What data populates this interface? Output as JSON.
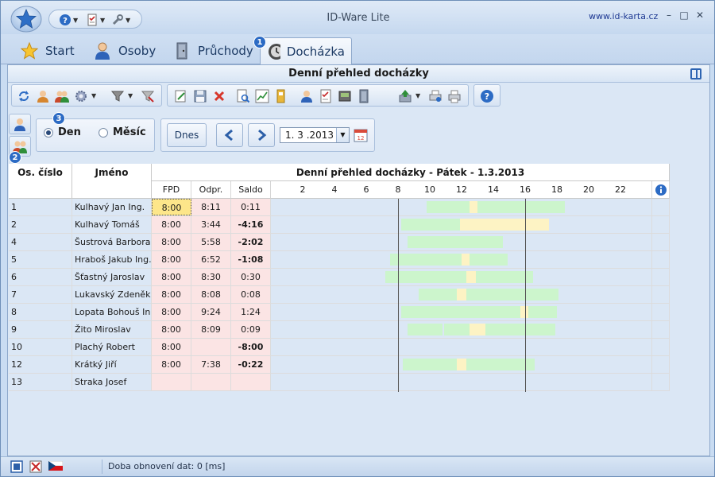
{
  "window": {
    "title": "ID-Ware Lite",
    "site_link": "www.id-karta.cz",
    "controls": [
      "minimize",
      "maximize",
      "close"
    ]
  },
  "tabs": [
    {
      "label": "Start",
      "icon": "star-icon",
      "active": false
    },
    {
      "label": "Osoby",
      "icon": "person-icon",
      "active": false
    },
    {
      "label": "Průchody",
      "icon": "door-icon",
      "active": false
    },
    {
      "label": "Docházka",
      "icon": "clock-icon",
      "active": true
    }
  ],
  "badges": {
    "tab": "1",
    "vtab": "2",
    "options": "3"
  },
  "panel": {
    "title": "Denní přehled docházky"
  },
  "options": {
    "radio_day": "Den",
    "radio_month": "Měsíc",
    "selected": "Den",
    "today_button": "Dnes",
    "date_value": "1. 3 .2013"
  },
  "table": {
    "headers": {
      "id": "Os. číslo",
      "name": "Jméno",
      "overview_title": "Denní přehled docházky - Pátek - 1.3.2013",
      "fpd": "FPD",
      "odpr": "Odpr.",
      "saldo": "Saldo"
    },
    "ticks": [
      "2",
      "4",
      "6",
      "8",
      "10",
      "12",
      "14",
      "16",
      "18",
      "20",
      "22"
    ],
    "rows": [
      {
        "id": "1",
        "name": "Kulhavý Jan Ing.",
        "fpd": "8:00",
        "odpr": "8:11",
        "saldo": "0:11",
        "neg": false,
        "selected": true,
        "segments": [
          {
            "from": 9.8,
            "to": 12.5,
            "type": "work"
          },
          {
            "from": 12.5,
            "to": 13.0,
            "type": "break"
          },
          {
            "from": 13.0,
            "to": 18.5,
            "type": "work"
          }
        ]
      },
      {
        "id": "2",
        "name": "Kulhavý Tomáš",
        "fpd": "8:00",
        "odpr": "3:44",
        "saldo": "-4:16",
        "neg": true,
        "selected": false,
        "segments": [
          {
            "from": 8.2,
            "to": 11.9,
            "type": "work"
          },
          {
            "from": 11.9,
            "to": 17.5,
            "type": "break"
          }
        ]
      },
      {
        "id": "4",
        "name": "Šustrová Barbora",
        "fpd": "8:00",
        "odpr": "5:58",
        "saldo": "-2:02",
        "neg": true,
        "selected": false,
        "segments": [
          {
            "from": 8.6,
            "to": 14.6,
            "type": "work"
          }
        ]
      },
      {
        "id": "5",
        "name": "Hraboš Jakub Ing.",
        "fpd": "8:00",
        "odpr": "6:52",
        "saldo": "-1:08",
        "neg": true,
        "selected": false,
        "segments": [
          {
            "from": 7.5,
            "to": 12.0,
            "type": "work"
          },
          {
            "from": 12.0,
            "to": 12.5,
            "type": "break"
          },
          {
            "from": 12.5,
            "to": 14.9,
            "type": "work"
          }
        ]
      },
      {
        "id": "6",
        "name": "Šťastný Jaroslav",
        "fpd": "8:00",
        "odpr": "8:30",
        "saldo": "0:30",
        "neg": false,
        "selected": false,
        "segments": [
          {
            "from": 7.2,
            "to": 11.6,
            "type": "work"
          },
          {
            "from": 11.6,
            "to": 12.3,
            "type": "work"
          },
          {
            "from": 12.3,
            "to": 12.9,
            "type": "break"
          },
          {
            "from": 12.9,
            "to": 16.5,
            "type": "work"
          }
        ]
      },
      {
        "id": "7",
        "name": "Lukavský Zdeněk",
        "fpd": "8:00",
        "odpr": "8:08",
        "saldo": "0:08",
        "neg": false,
        "selected": false,
        "segments": [
          {
            "from": 9.3,
            "to": 11.7,
            "type": "work"
          },
          {
            "from": 11.7,
            "to": 12.3,
            "type": "break"
          },
          {
            "from": 12.3,
            "to": 18.1,
            "type": "work"
          }
        ]
      },
      {
        "id": "8",
        "name": "Lopata Bohouš Ing.",
        "fpd": "8:00",
        "odpr": "9:24",
        "saldo": "1:24",
        "neg": false,
        "selected": false,
        "segments": [
          {
            "from": 8.2,
            "to": 15.7,
            "type": "work"
          },
          {
            "from": 15.7,
            "to": 16.2,
            "type": "break"
          },
          {
            "from": 16.2,
            "to": 18.0,
            "type": "work"
          }
        ]
      },
      {
        "id": "9",
        "name": "Žito Miroslav",
        "fpd": "8:00",
        "odpr": "8:09",
        "saldo": "0:09",
        "neg": false,
        "selected": false,
        "segments": [
          {
            "from": 8.6,
            "to": 10.8,
            "type": "work"
          },
          {
            "from": 10.9,
            "to": 12.5,
            "type": "work"
          },
          {
            "from": 12.5,
            "to": 13.5,
            "type": "break"
          },
          {
            "from": 13.5,
            "to": 17.9,
            "type": "work"
          }
        ]
      },
      {
        "id": "10",
        "name": "Plachý Robert",
        "fpd": "8:00",
        "odpr": "",
        "saldo": "-8:00",
        "neg": true,
        "selected": false,
        "segments": []
      },
      {
        "id": "12",
        "name": "Krátký Jiří",
        "fpd": "8:00",
        "odpr": "7:38",
        "saldo": "-0:22",
        "neg": true,
        "selected": false,
        "segments": [
          {
            "from": 8.3,
            "to": 11.7,
            "type": "work"
          },
          {
            "from": 11.7,
            "to": 12.3,
            "type": "break"
          },
          {
            "from": 12.3,
            "to": 16.6,
            "type": "work"
          }
        ]
      },
      {
        "id": "13",
        "name": "Straka Josef",
        "fpd": "",
        "odpr": "",
        "saldo": "",
        "neg": false,
        "selected": false,
        "segments": []
      }
    ],
    "markers": [
      8,
      16
    ]
  },
  "colors": {
    "work": "#ccf5cc",
    "break": "#fdf3c4",
    "accent": "#2c6bc4",
    "pink": "#fbe4e4"
  },
  "status": {
    "text": "Doba obnovení dat:  0 [ms]"
  }
}
